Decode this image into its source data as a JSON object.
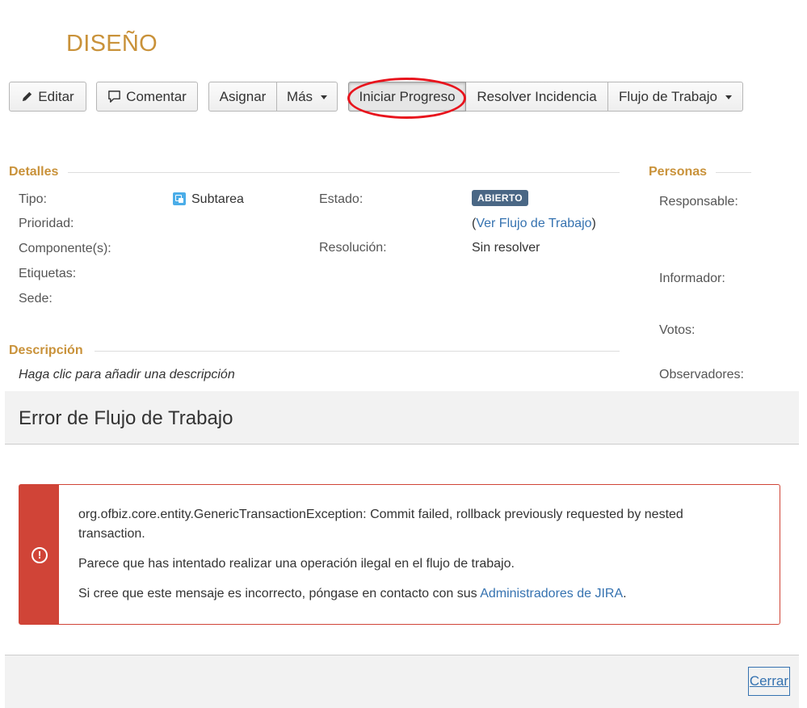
{
  "issue": {
    "title": "DISEÑO"
  },
  "toolbar": {
    "edit": "Editar",
    "comment": "Comentar",
    "assign": "Asignar",
    "more": "Más",
    "start_progress": "Iniciar Progreso",
    "resolve": "Resolver Incidencia",
    "workflow": "Flujo de Trabajo"
  },
  "details": {
    "heading": "Detalles",
    "type_label": "Tipo:",
    "type_value": "Subtarea",
    "priority_label": "Prioridad:",
    "components_label": "Componente(s):",
    "labels_label": "Etiquetas:",
    "site_label": "Sede:",
    "status_label": "Estado:",
    "status_value": "ABIERTO",
    "view_workflow_open": "(",
    "view_workflow_link": "Ver Flujo de Trabajo",
    "view_workflow_close": ")",
    "resolution_label": "Resolución:",
    "resolution_value": "Sin resolver"
  },
  "people": {
    "heading": "Personas",
    "assignee_label": "Responsable:",
    "reporter_label": "Informador:",
    "votes_label": "Votos:",
    "watchers_label": "Observadores:"
  },
  "description": {
    "heading": "Descripción",
    "placeholder": "Haga clic para añadir una descripción"
  },
  "dialog": {
    "title": "Error de Flujo de Trabajo",
    "error_line1": "org.ofbiz.core.entity.GenericTransactionException: Commit failed, rollback previously requested by nested",
    "error_line2": "transaction.",
    "message": "Parece que has intentado realizar una operación ilegal en el flujo de trabajo.",
    "contact_prefix": "Si cree que este mensaje es incorrecto, póngase en contacto con sus ",
    "contact_link": "Administradores de JIRA",
    "contact_suffix": ".",
    "close": "Cerrar"
  },
  "colors": {
    "accent": "#c9923a",
    "error": "#d04437",
    "link": "#3572b0",
    "badge": "#4a6785",
    "highlight": "#e8141d"
  }
}
